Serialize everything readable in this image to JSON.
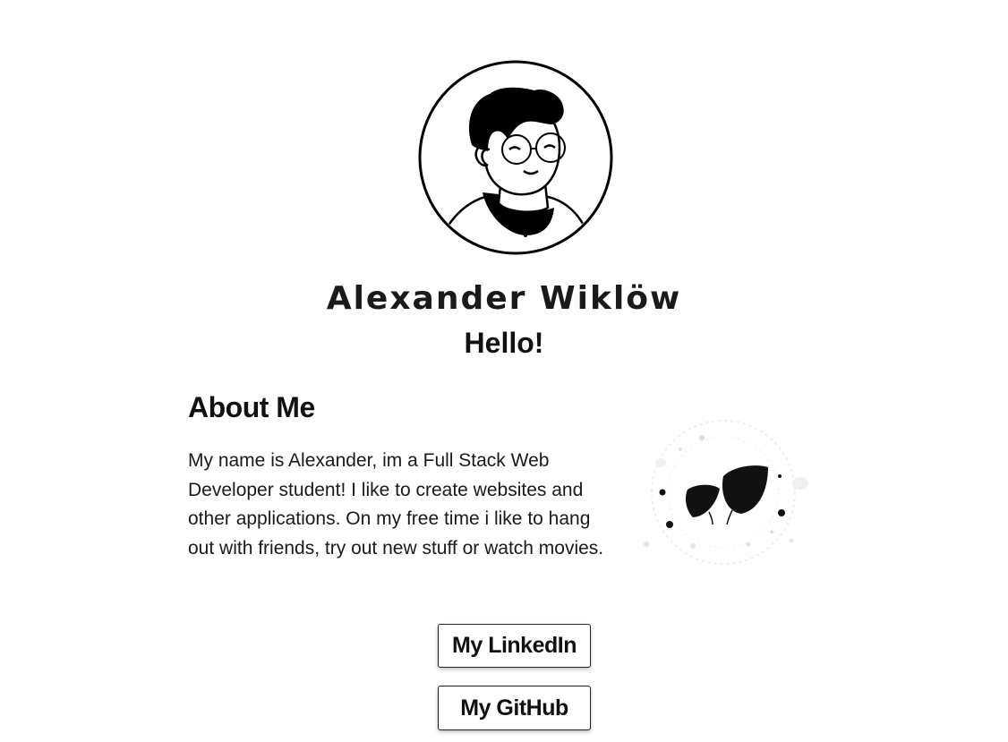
{
  "profile": {
    "name": "Alexander Wiklöw",
    "greeting": "Hello!",
    "avatar_icon": "person-with-glasses-avatar"
  },
  "about": {
    "title": "About Me",
    "text": "My name is Alexander, im a Full Stack Web Developer student! I like to create websites and other applications. On my free time i like to hang out with friends, try out new stuff or watch movies.",
    "illustration_icon": "leaves-illustration"
  },
  "links": {
    "linkedin_label": "My LinkedIn",
    "github_label": "My GitHub"
  },
  "colors": {
    "background": "#ffffff",
    "text": "#111111",
    "border": "#222222"
  }
}
